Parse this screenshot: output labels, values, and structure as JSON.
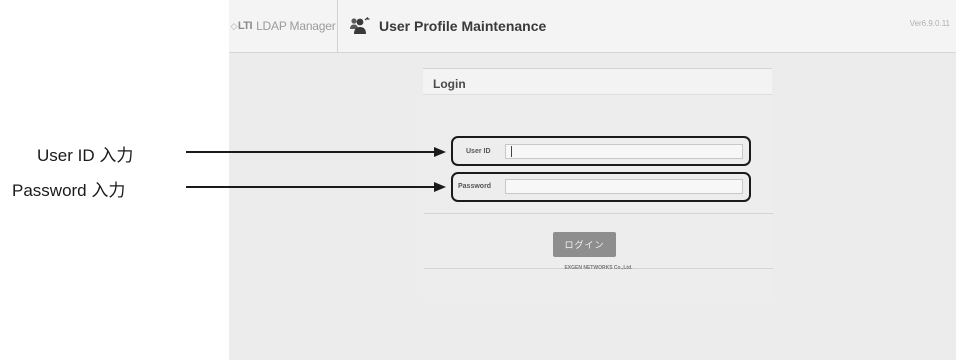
{
  "header": {
    "brand_logo": "LTI",
    "brand_name": "LDAP Manager",
    "app_title": "User Profile Maintenance",
    "version": "Ver6.9.0.11"
  },
  "login": {
    "title": "Login",
    "user_id_label": "User ID",
    "user_id_value": "",
    "password_label": "Password",
    "password_value": "",
    "button_label": "ログイン",
    "footer": "EXGEN NETWORKS Co.,Ltd."
  },
  "annotations": {
    "user_id_callout": "User ID 入力",
    "password_callout": "Password 入力"
  },
  "icons": {
    "brand": "lti-logo-icon",
    "app": "users-icon"
  },
  "colors": {
    "app_background": "#ececec",
    "button": "#8e8e8e",
    "annotation": "#1a1a1a"
  }
}
